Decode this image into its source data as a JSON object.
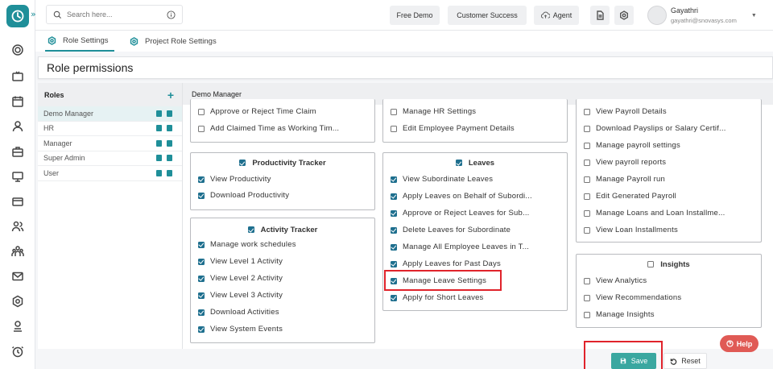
{
  "search": {
    "placeholder": "Search here..."
  },
  "topbar": {
    "free_demo": "Free Demo",
    "customer_success": "Customer Success",
    "agent": "Agent"
  },
  "user": {
    "name": "Gayathri",
    "email": "gayathri@snovasys.com"
  },
  "tabs": [
    {
      "label": "Role Settings"
    },
    {
      "label": "Project Role Settings"
    }
  ],
  "page": {
    "title": "Role permissions"
  },
  "roles": {
    "header": "Roles",
    "add": "+",
    "items": [
      {
        "label": "Demo Manager"
      },
      {
        "label": "HR"
      },
      {
        "label": "Manager"
      },
      {
        "label": "Super Admin"
      },
      {
        "label": "User"
      }
    ]
  },
  "selected_role": "Demo Manager",
  "col1": {
    "top": [
      {
        "label": "Approve or Reject Time Claim",
        "checked": false
      },
      {
        "label": "Add Claimed Time as Working Tim...",
        "checked": false
      }
    ],
    "productivity": {
      "title": "Productivity Tracker",
      "items": [
        {
          "label": "View Productivity",
          "checked": true
        },
        {
          "label": "Download Productivity",
          "checked": true
        }
      ]
    },
    "activity": {
      "title": "Activity Tracker",
      "items": [
        {
          "label": "Manage work schedules",
          "checked": true
        },
        {
          "label": "View Level 1 Activity",
          "checked": true
        },
        {
          "label": "View Level 2 Activity",
          "checked": true
        },
        {
          "label": "View Level 3 Activity",
          "checked": true
        },
        {
          "label": "Download Activities",
          "checked": true
        },
        {
          "label": "View System Events",
          "checked": true
        }
      ]
    }
  },
  "col2": {
    "top": [
      {
        "label": "Manage HR Settings",
        "checked": false
      },
      {
        "label": "Edit Employee Payment Details",
        "checked": false
      }
    ],
    "leaves": {
      "title": "Leaves",
      "items": [
        {
          "label": "View Subordinate Leaves",
          "checked": true
        },
        {
          "label": "Apply Leaves on Behalf of Subordi...",
          "checked": true
        },
        {
          "label": "Approve or Reject Leaves for Sub...",
          "checked": true
        },
        {
          "label": "Delete Leaves for Subordinate",
          "checked": true
        },
        {
          "label": "Manage All Employee Leaves in T...",
          "checked": true
        },
        {
          "label": "Apply Leaves for Past Days",
          "checked": true
        },
        {
          "label": "Manage Leave Settings",
          "checked": true
        },
        {
          "label": "Apply for Short Leaves",
          "checked": true
        }
      ]
    }
  },
  "col3": {
    "payroll": [
      {
        "label": "View Payroll Details",
        "checked": false
      },
      {
        "label": "Download Payslips or Salary Certif...",
        "checked": false
      },
      {
        "label": "Manage payroll settings",
        "checked": false
      },
      {
        "label": "View payroll reports",
        "checked": false
      },
      {
        "label": "Manage Payroll run",
        "checked": false
      },
      {
        "label": "Edit Generated Payroll",
        "checked": false
      },
      {
        "label": "Manage Loans and Loan Installme...",
        "checked": false
      },
      {
        "label": "View Loan Installments",
        "checked": false
      }
    ],
    "insights": {
      "title": "Insights",
      "items": [
        {
          "label": "View Analytics",
          "checked": false
        },
        {
          "label": "View Recommendations",
          "checked": false
        },
        {
          "label": "Manage Insights",
          "checked": false
        }
      ]
    }
  },
  "actions": {
    "save": "Save",
    "reset": "Reset",
    "help": "Help"
  },
  "colors": {
    "accent": "#1f8f99",
    "checkbox": "#1e6f8e",
    "save": "#3aa7a0",
    "highlight": "#e0232b",
    "help": "#e05a55"
  }
}
